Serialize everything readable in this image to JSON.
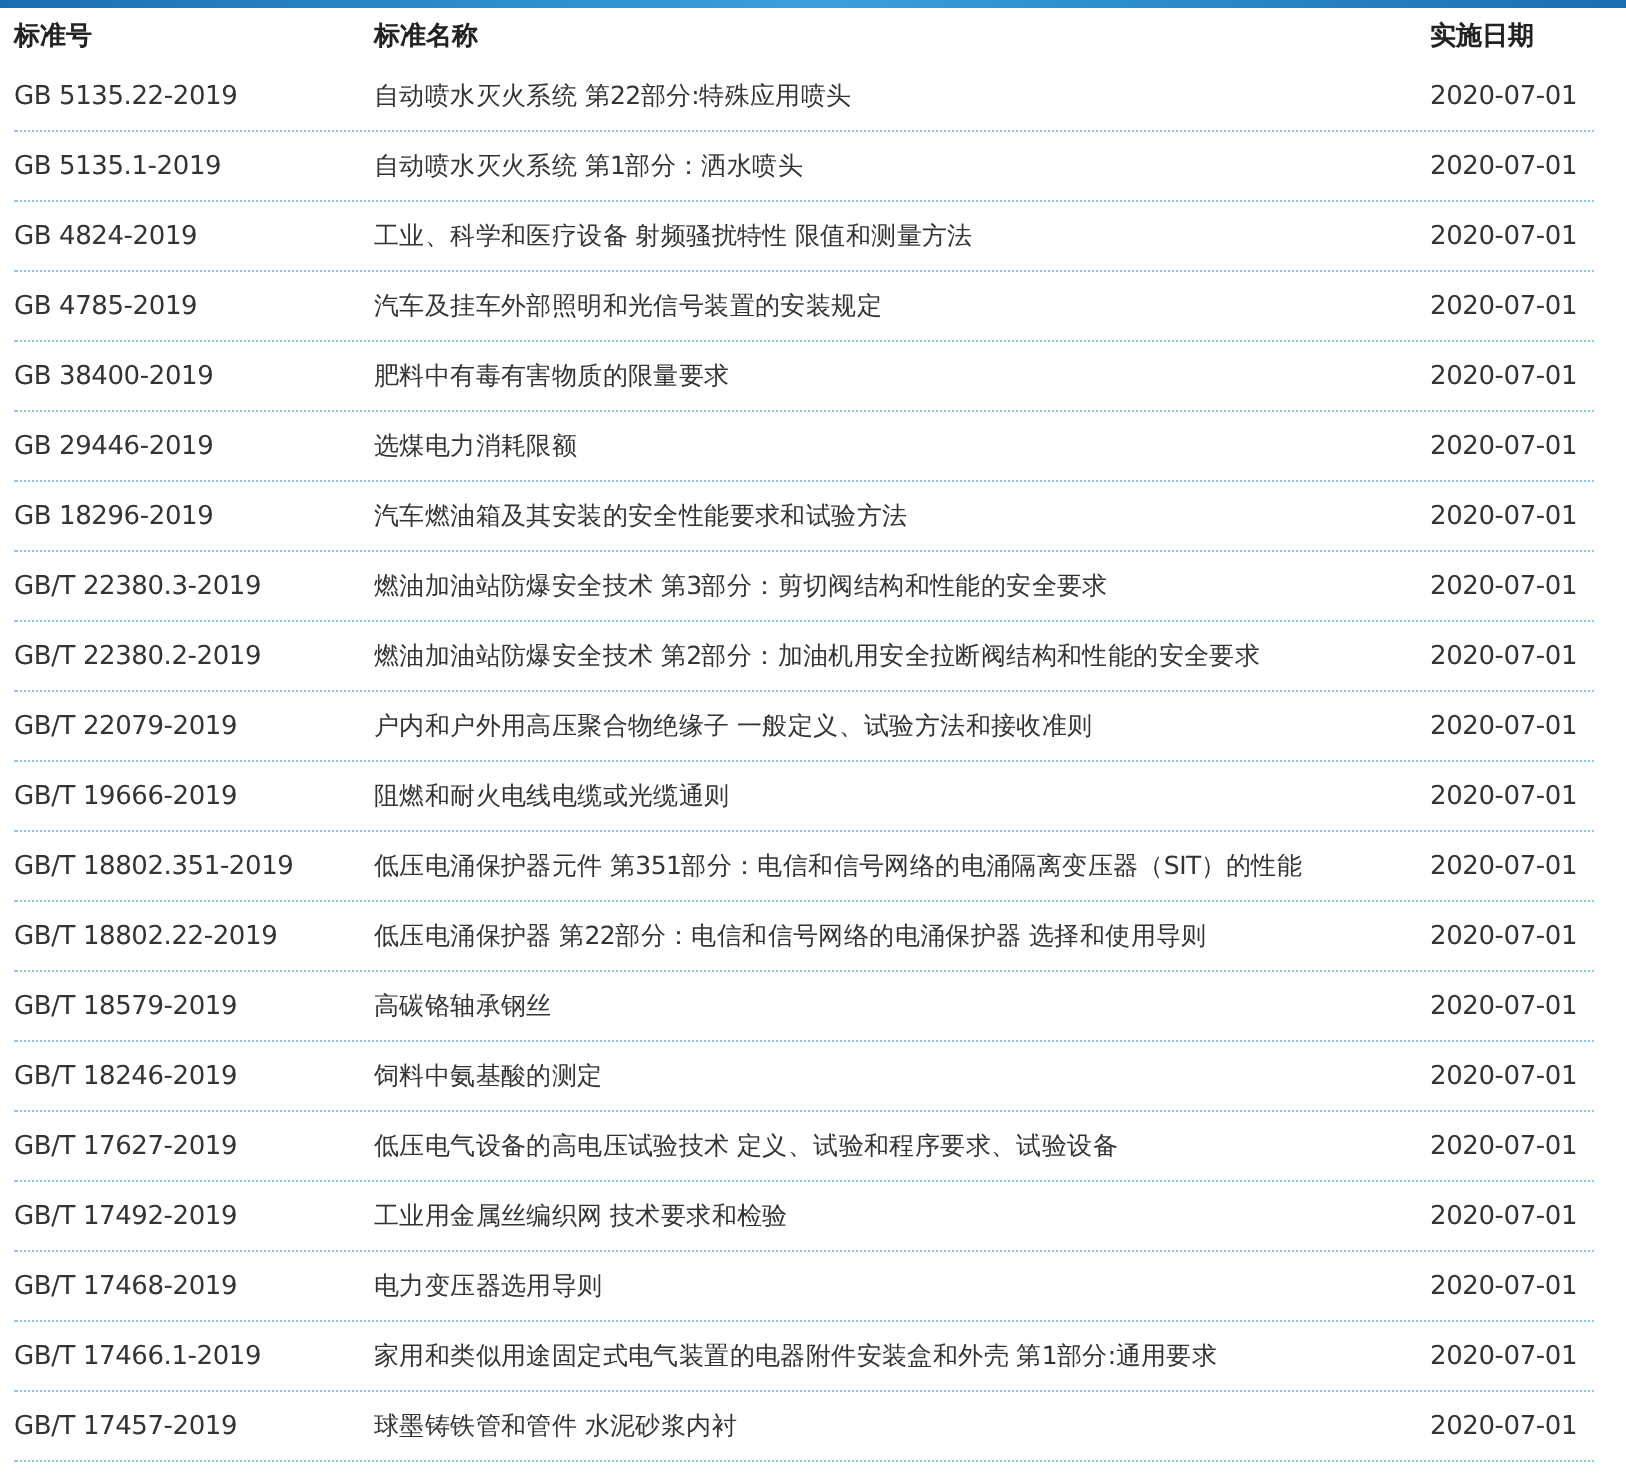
{
  "columns": [
    "标准号",
    "标准名称",
    "实施日期"
  ],
  "rows": [
    [
      "GB 5135.22-2019",
      "自动喷水灭火系统 第22部分:特殊应用喷头",
      "2020-07-01"
    ],
    [
      "GB 5135.1-2019",
      "自动喷水灭火系统 第1部分：洒水喷头",
      "2020-07-01"
    ],
    [
      "GB 4824-2019",
      "工业、科学和医疗设备 射频骚扰特性 限值和测量方法",
      "2020-07-01"
    ],
    [
      "GB 4785-2019",
      "汽车及挂车外部照明和光信号装置的安装规定",
      "2020-07-01"
    ],
    [
      "GB 38400-2019",
      "肥料中有毒有害物质的限量要求",
      "2020-07-01"
    ],
    [
      "GB 29446-2019",
      "选煤电力消耗限额",
      "2020-07-01"
    ],
    [
      "GB 18296-2019",
      "汽车燃油箱及其安装的安全性能要求和试验方法",
      "2020-07-01"
    ],
    [
      "GB/T 22380.3-2019",
      "燃油加油站防爆安全技术 第3部分：剪切阀结构和性能的安全要求",
      "2020-07-01"
    ],
    [
      "GB/T 22380.2-2019",
      "燃油加油站防爆安全技术 第2部分：加油机用安全拉断阀结构和性能的安全要求",
      "2020-07-01"
    ],
    [
      "GB/T 22079-2019",
      "户内和户外用高压聚合物绝缘子 一般定义、试验方法和接收准则",
      "2020-07-01"
    ],
    [
      "GB/T 19666-2019",
      "阻燃和耐火电线电缆或光缆通则",
      "2020-07-01"
    ],
    [
      "GB/T 18802.351-2019",
      "低压电涌保护器元件 第351部分：电信和信号网络的电涌隔离变压器（SIT）的性能",
      "2020-07-01"
    ],
    [
      "GB/T 18802.22-2019",
      "低压电涌保护器 第22部分：电信和信号网络的电涌保护器 选择和使用导则",
      "2020-07-01"
    ],
    [
      "GB/T 18579-2019",
      "高碳铬轴承钢丝",
      "2020-07-01"
    ],
    [
      "GB/T 18246-2019",
      "饲料中氨基酸的测定",
      "2020-07-01"
    ],
    [
      "GB/T 17627-2019",
      "低压电气设备的高电压试验技术 定义、试验和程序要求、试验设备",
      "2020-07-01"
    ],
    [
      "GB/T 17492-2019",
      "工业用金属丝编织网 技术要求和检验",
      "2020-07-01"
    ],
    [
      "GB/T 17468-2019",
      "电力变压器选用导则",
      "2020-07-01"
    ],
    [
      "GB/T 17466.1-2019",
      "家用和类似用途固定式电气装置的电器附件安装盒和外壳 第1部分:通用要求",
      "2020-07-01"
    ],
    [
      "GB/T 17457-2019",
      "球墨铸铁管和管件 水泥砂浆内衬",
      "2020-07-01"
    ]
  ]
}
